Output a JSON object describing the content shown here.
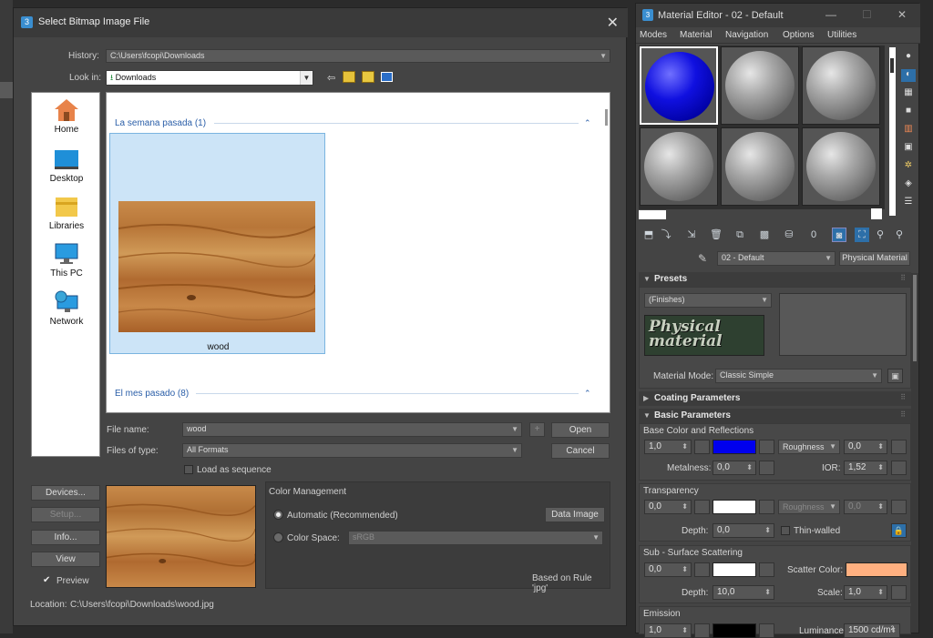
{
  "dialog": {
    "app_icon": "3",
    "title": "Select Bitmap Image File",
    "close_icon": "✕",
    "history_label": "History:",
    "history_value": "C:\\Users\\fcopi\\Downloads",
    "lookin_label": "Look in:",
    "lookin_value": "Downloads",
    "places": [
      "Home",
      "Desktop",
      "Libraries",
      "This PC",
      "Network"
    ],
    "groups": [
      {
        "label": "La semana pasada (1)"
      },
      {
        "label": "El mes pasado (8)"
      }
    ],
    "file_tile_name": "wood",
    "filename_label": "File name:",
    "filename_value": "wood",
    "filetype_label": "Files of type:",
    "filetype_value": "All Formats",
    "open_button": "Open",
    "cancel_button": "Cancel",
    "plus_button": "+",
    "sequence_label": "Load as sequence",
    "devices_button": "Devices...",
    "setup_button": "Setup...",
    "info_button": "Info...",
    "view_button": "View",
    "preview_label": "Preview",
    "color_mgmt_title": "Color Management",
    "automatic_label": "Automatic (Recommended)",
    "data_image_button": "Data Image",
    "color_space_label": "Color Space:",
    "color_space_value": "sRGB",
    "rule_text": "Based on Rule 'jpg'",
    "location_label": "Location:",
    "location_value": "C:\\Users\\fcopi\\Downloads\\wood.jpg"
  },
  "material_editor": {
    "app_icon": "3",
    "title": "Material Editor - 02 - Default",
    "menu": [
      "Modes",
      "Material",
      "Navigation",
      "Options",
      "Utilities"
    ],
    "material_name": "02 - Default",
    "material_type": "Physical Material",
    "presets_header": "Presets",
    "presets_value": "(Finishes)",
    "logo_text": "Physical material",
    "material_mode_label": "Material Mode:",
    "material_mode_value": "Classic Simple",
    "coating_header": "Coating Parameters",
    "basic_header": "Basic Parameters",
    "base_color_title": "Base Color and Reflections",
    "base_weight": "1,0",
    "roughness_label": "Roughness",
    "roughness_value": "0,0",
    "metalness_label": "Metalness:",
    "metalness_value": "0,0",
    "ior_label": "IOR:",
    "ior_value": "1,52",
    "transparency_title": "Transparency",
    "transparency_weight": "0,0",
    "trans_roughness_label": "Roughness",
    "trans_roughness_value": "0,0",
    "depth_label": "Depth:",
    "trans_depth_value": "0,0",
    "thin_walled_label": "Thin-walled",
    "sss_title": "Sub - Surface Scattering",
    "sss_weight": "0,0",
    "scatter_color_label": "Scatter Color:",
    "sss_depth_value": "10,0",
    "scale_label": "Scale:",
    "scale_value": "1,0",
    "emission_title": "Emission",
    "emission_weight": "1,0",
    "luminance_label": "Luminance:",
    "luminance_value": "1500 cd/m²",
    "colors": {
      "base": "#0000ee",
      "transparency": "#ffffff",
      "sss": "#ffffff",
      "scatter": "#ffb080",
      "emission": "#000000"
    }
  }
}
